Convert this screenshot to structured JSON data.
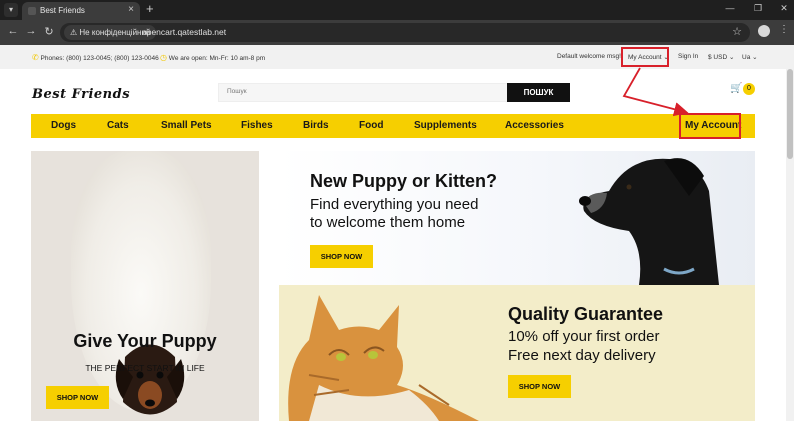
{
  "browser": {
    "tab_title": "Best Friends",
    "new_tab": "+",
    "site_info": "Не конфіденційний",
    "url": "opencart.qatestlab.net"
  },
  "topbar": {
    "phones": "Phones: (800) 123-0045; (800) 123-0046",
    "hours": "We are open: Mn-Fr: 10 am-8 pm",
    "welcome": "Default welcome msg!",
    "my_account": "My Account",
    "sign_in": "Sign In",
    "currency": "$ USD",
    "language": "Ua"
  },
  "header": {
    "logo": "Best Friends",
    "search_placeholder": "Пошук",
    "search_button": "ПОШУК",
    "cart_count": "0"
  },
  "nav": {
    "items": [
      "Dogs",
      "Cats",
      "Small Pets",
      "Fishes",
      "Birds",
      "Food",
      "Supplements",
      "Accessories"
    ],
    "my_account": "My Account"
  },
  "promo_left": {
    "title": "Give Your Puppy",
    "subtitle": "THE PERFECT START IN LIFE",
    "button": "SHOP NOW"
  },
  "promo_top": {
    "title": "New Puppy or Kitten?",
    "line1": "Find everything you need",
    "line2": "to welcome them home",
    "button": "SHOP NOW"
  },
  "promo_bottom": {
    "title": "Quality Guarantee",
    "line1": "10% off your first order",
    "line2": "Free next day delivery",
    "button": "SHOP NOW"
  },
  "colors": {
    "accent": "#f6cf00",
    "annotation": "#d8202a"
  }
}
